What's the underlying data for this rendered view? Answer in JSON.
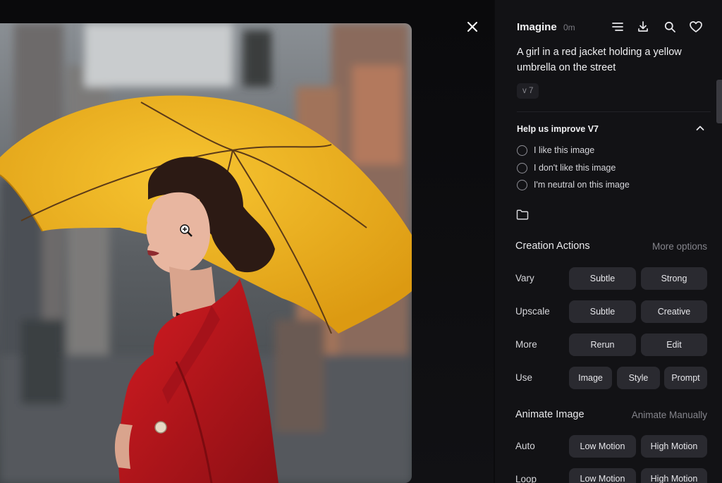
{
  "panel": {
    "title": "Imagine",
    "time": "0m",
    "prompt": "A girl in a red jacket holding a yellow umbrella on the street",
    "version": "v 7"
  },
  "feedback": {
    "title": "Help us improve V7",
    "options": [
      "I like this image",
      "I don't like this image",
      "I'm neutral on this image"
    ]
  },
  "creation": {
    "title": "Creation Actions",
    "more": "More options",
    "vary": {
      "label": "Vary",
      "buttons": [
        "Subtle",
        "Strong"
      ]
    },
    "upscale": {
      "label": "Upscale",
      "buttons": [
        "Subtle",
        "Creative"
      ]
    },
    "more_row": {
      "label": "More",
      "buttons": [
        "Rerun",
        "Edit"
      ]
    },
    "use": {
      "label": "Use",
      "buttons": [
        "Image",
        "Style",
        "Prompt"
      ]
    }
  },
  "animate": {
    "title": "Animate Image",
    "manual": "Animate Manually",
    "auto": {
      "label": "Auto",
      "buttons": [
        "Low Motion",
        "High Motion"
      ]
    },
    "loop": {
      "label": "Loop",
      "buttons": [
        "Low Motion",
        "High Motion"
      ]
    }
  },
  "icons": [
    "close-icon",
    "list-icon",
    "download-icon",
    "search-icon",
    "heart-icon",
    "chevron-up-icon",
    "folder-icon",
    "zoom-in-cursor-icon"
  ],
  "colors": {
    "panel_bg": "#121215",
    "button_bg": "#2a2a30",
    "umbrella": "#f2b51e",
    "jacket": "#c0161c"
  }
}
